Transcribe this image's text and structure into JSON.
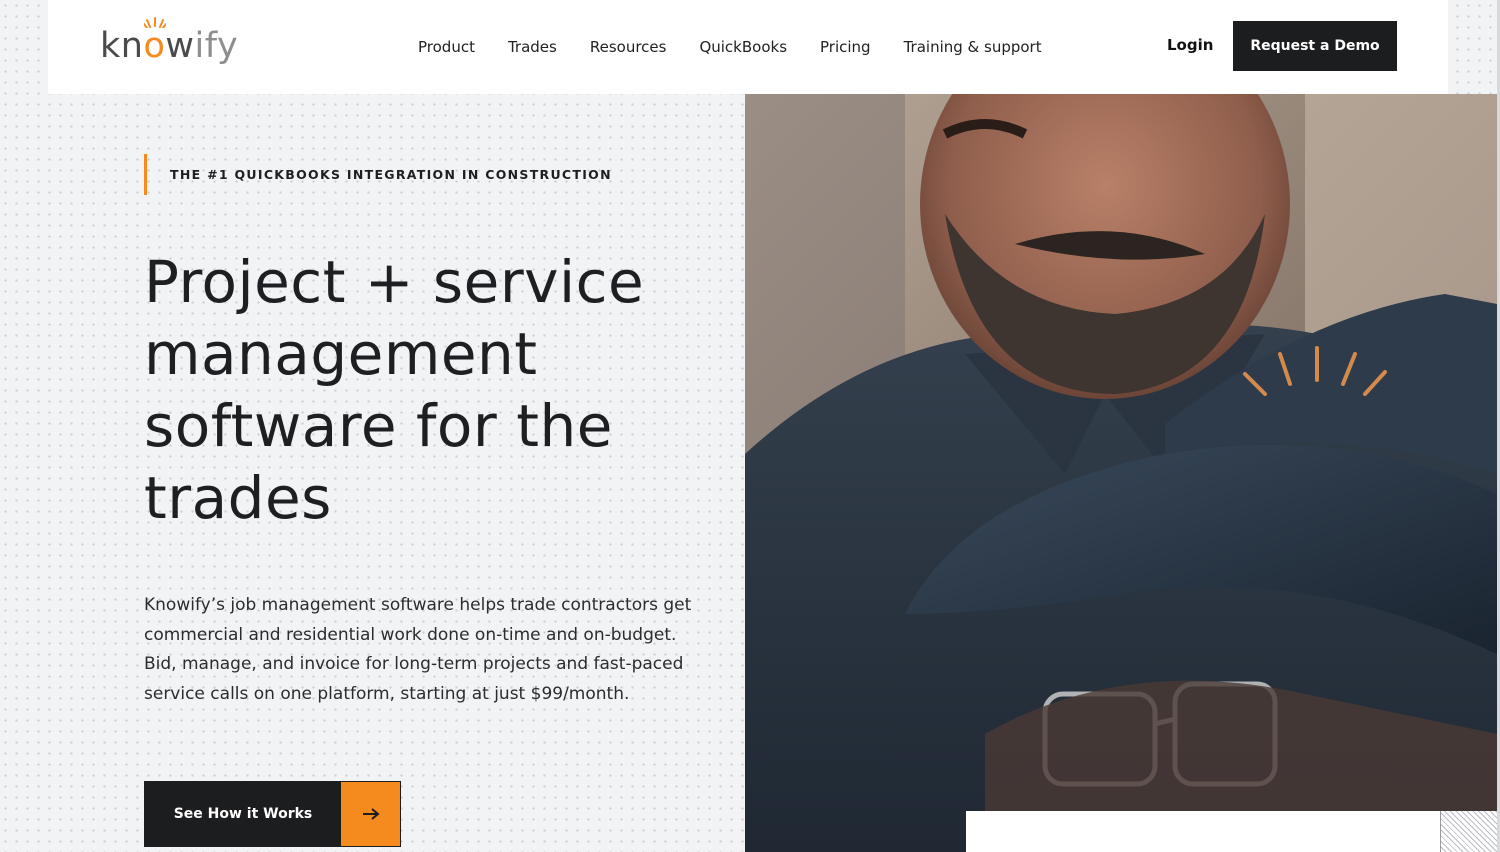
{
  "brand": {
    "logo_part1": "kn",
    "logo_o": "o",
    "logo_part2": "w",
    "logo_part3": "ify",
    "accent_color": "#f58a1f",
    "dark_color": "#1c1d1f"
  },
  "nav": {
    "items": [
      {
        "label": "Product"
      },
      {
        "label": "Trades"
      },
      {
        "label": "Resources"
      },
      {
        "label": "QuickBooks"
      },
      {
        "label": "Pricing"
      },
      {
        "label": "Training & support"
      }
    ],
    "login_label": "Login",
    "demo_label": "Request a Demo"
  },
  "hero": {
    "eyebrow": "THE #1 QUICKBOOKS INTEGRATION IN CONSTRUCTION",
    "headline_lines": [
      "Project + service",
      "management",
      "software for the",
      "trades"
    ],
    "paragraph": "Knowify’s job management software helps trade contractors get commercial and residential work done on-time and on-budget. Bid, manage, and invoice for long-term projects and fast-paced service calls on one platform, starting at just $99/month.",
    "cta_label": "See How it Works",
    "cta_icon": "arrow-right-icon"
  },
  "media": {
    "image_subject": "person-photo",
    "icons": [
      "arrow-right-icon",
      "logo-sun-icon"
    ]
  }
}
